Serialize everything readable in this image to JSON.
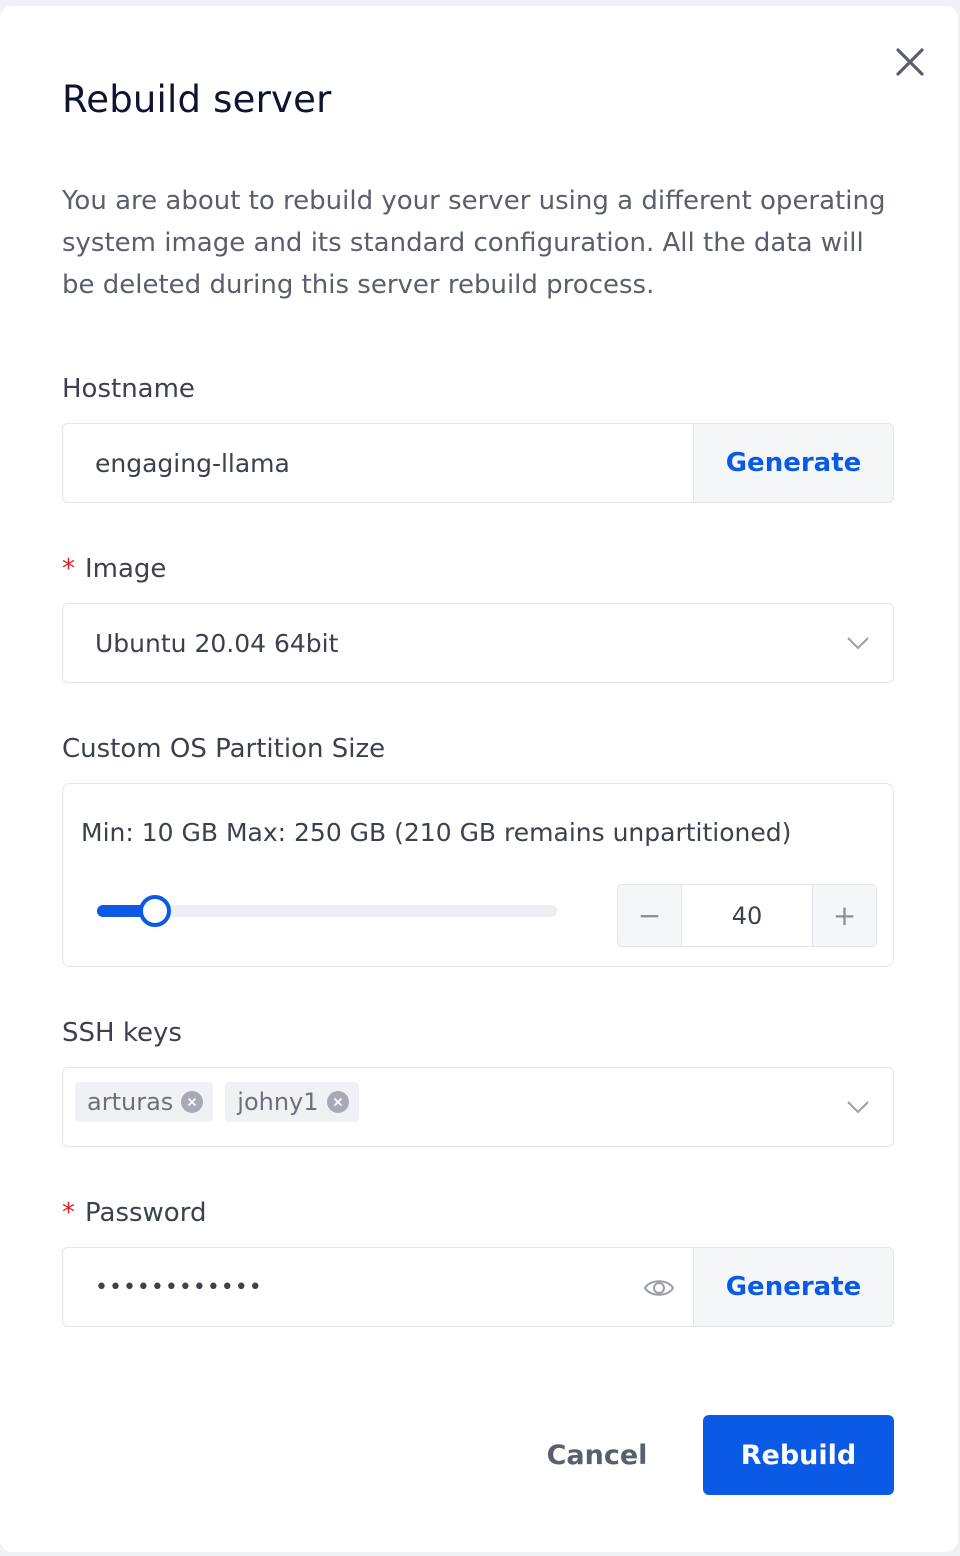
{
  "modal": {
    "title": "Rebuild server",
    "description": "You are about to rebuild your server using a different operating system image and its standard configuration. All the data will be deleted during this server rebuild process."
  },
  "hostname": {
    "label": "Hostname",
    "value": "engaging-llama",
    "generate_label": "Generate"
  },
  "image": {
    "required_mark": "*",
    "label": "Image",
    "selected": "Ubuntu 20.04 64bit"
  },
  "partition": {
    "label": "Custom OS Partition Size",
    "range_text": "Min: 10 GB Max: 250 GB (210 GB remains unpartitioned)",
    "min": 10,
    "max": 250,
    "value": "40",
    "minus_label": "−",
    "plus_label": "+"
  },
  "ssh_keys": {
    "label": "SSH keys",
    "tags": [
      "arturas",
      "johny1"
    ]
  },
  "password": {
    "required_mark": "*",
    "label": "Password",
    "masked_value": "••••••••••••",
    "generate_label": "Generate"
  },
  "footer": {
    "cancel_label": "Cancel",
    "rebuild_label": "Rebuild"
  },
  "icons": {
    "close": "close-icon",
    "chevron": "chevron-down-icon",
    "eye": "eye-icon",
    "tag_remove": "close-circle-icon"
  },
  "colors": {
    "primary": "#0a5ae6",
    "required": "#e02020",
    "border": "#e3e5ea"
  }
}
